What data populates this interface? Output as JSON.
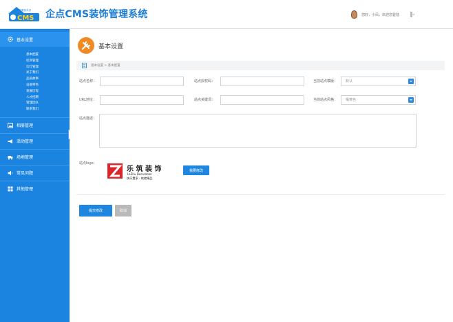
{
  "app": {
    "logo_text_top": "浦航服务共识",
    "logo_text_main": "CMS",
    "title": "企点CMS装饰管理系统",
    "user_greeting": "您好，小凤，欢迎您登陆"
  },
  "sidebar": {
    "sections": [
      {
        "label": "基本设置",
        "icon": "gear-icon",
        "items": [
          "基本配置",
          "栏目管理",
          "幻灯管理",
          "关于我们",
          "品质故事",
          "设备特色",
          "发展历程",
          "人才招聘",
          "管理团队",
          "联系我们"
        ]
      },
      {
        "label": "相册管理",
        "icon": "image-icon"
      },
      {
        "label": "活动管理",
        "icon": "megaphone-icon"
      },
      {
        "label": "场地管理",
        "icon": "truck-icon"
      },
      {
        "label": "常见问题",
        "icon": "speaker-icon"
      },
      {
        "label": "其他管理",
        "icon": "grid-icon"
      }
    ]
  },
  "page": {
    "title": "基本设置",
    "breadcrumb": "基本设置 > 基本配置"
  },
  "form": {
    "site_name_label": "站点名称：",
    "site_name_value": "",
    "auth_code_label": "站点授权码：",
    "auth_code_value": "",
    "template_label": "当前站点模版：",
    "template_value": "默认",
    "url_label": "URL地址：",
    "url_value": "",
    "keywords_label": "站点关键词：",
    "keywords_value": "",
    "style_label": "当前站点风格：",
    "style_value": "橘黄色",
    "desc_label": "站点描述：",
    "desc_value": "",
    "logo_label": "站点logo：",
    "logo_brand_cn": "乐 筑 装 饰",
    "logo_brand_en": "LeZhu Decoration",
    "logo_slogan": "快乐置家 · 筑就精品",
    "change_logo_button": "我要修改",
    "submit_button": "提交修改",
    "cancel_button": "取消"
  },
  "colors": {
    "sidebar": "#1a84e0",
    "accent": "#1f86e0",
    "head_icon": "#f08a24",
    "logo_red": "#d9252b"
  }
}
